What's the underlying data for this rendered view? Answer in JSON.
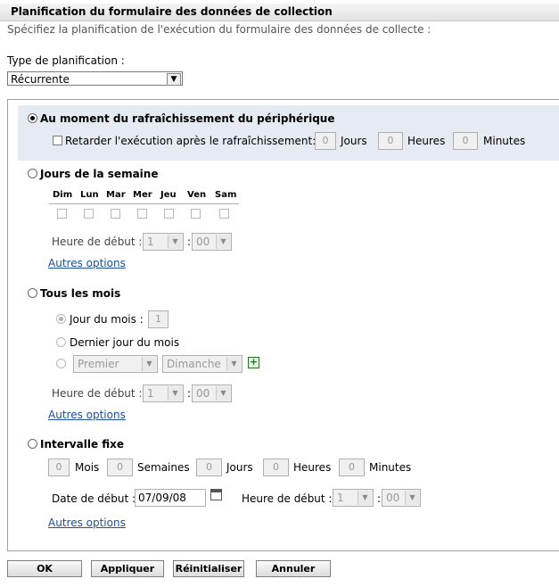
{
  "header": {
    "title": "Planification du formulaire des données de collection",
    "subtitle": "Spécifiez la planification de l'exécution du formulaire des données de collecte :"
  },
  "schedule_type": {
    "label": "Type de planification :",
    "value": "Récurrente"
  },
  "refresh": {
    "label": "Au moment du rafraîchissement du périphérique",
    "delay_label": "Retarder l'exécution après le rafraîchissement:",
    "days_value": "0",
    "days_label": "Jours",
    "hours_value": "0",
    "hours_label": "Heures",
    "minutes_value": "0",
    "minutes_label": "Minutes"
  },
  "weekdays": {
    "label": "Jours de la semaine",
    "days": [
      "Dim",
      "Lun",
      "Mar",
      "Mer",
      "Jeu",
      "Ven",
      "Sam"
    ],
    "start_label": "Heure de début :",
    "hour": "1",
    "minute": "00",
    "more": "Autres options"
  },
  "monthly": {
    "label": "Tous les mois",
    "day_of_month_label": "Jour du mois :",
    "day_of_month_value": "1",
    "last_day_label": "Dernier jour du mois",
    "ordinal": "Premier",
    "weekday": "Dimanche",
    "start_label": "Heure de début :",
    "hour": "1",
    "minute": "00",
    "more": "Autres options"
  },
  "fixed": {
    "label": "Intervalle fixe",
    "months_value": "0",
    "months_label": "Mois",
    "weeks_value": "0",
    "weeks_label": "Semaines",
    "days_value": "0",
    "days_label": "Jours",
    "hours_value": "0",
    "hours_label": "Heures",
    "minutes_value": "0",
    "minutes_label": "Minutes",
    "start_date_label": "Date de début :",
    "start_date": "07/09/08",
    "start_time_label": "Heure de début :",
    "hour": "1",
    "minute": "00",
    "more": "Autres options"
  },
  "buttons": {
    "ok": "OK",
    "apply": "Appliquer",
    "reset": "Réinitialiser",
    "cancel": "Annuler"
  },
  "colon": ":"
}
